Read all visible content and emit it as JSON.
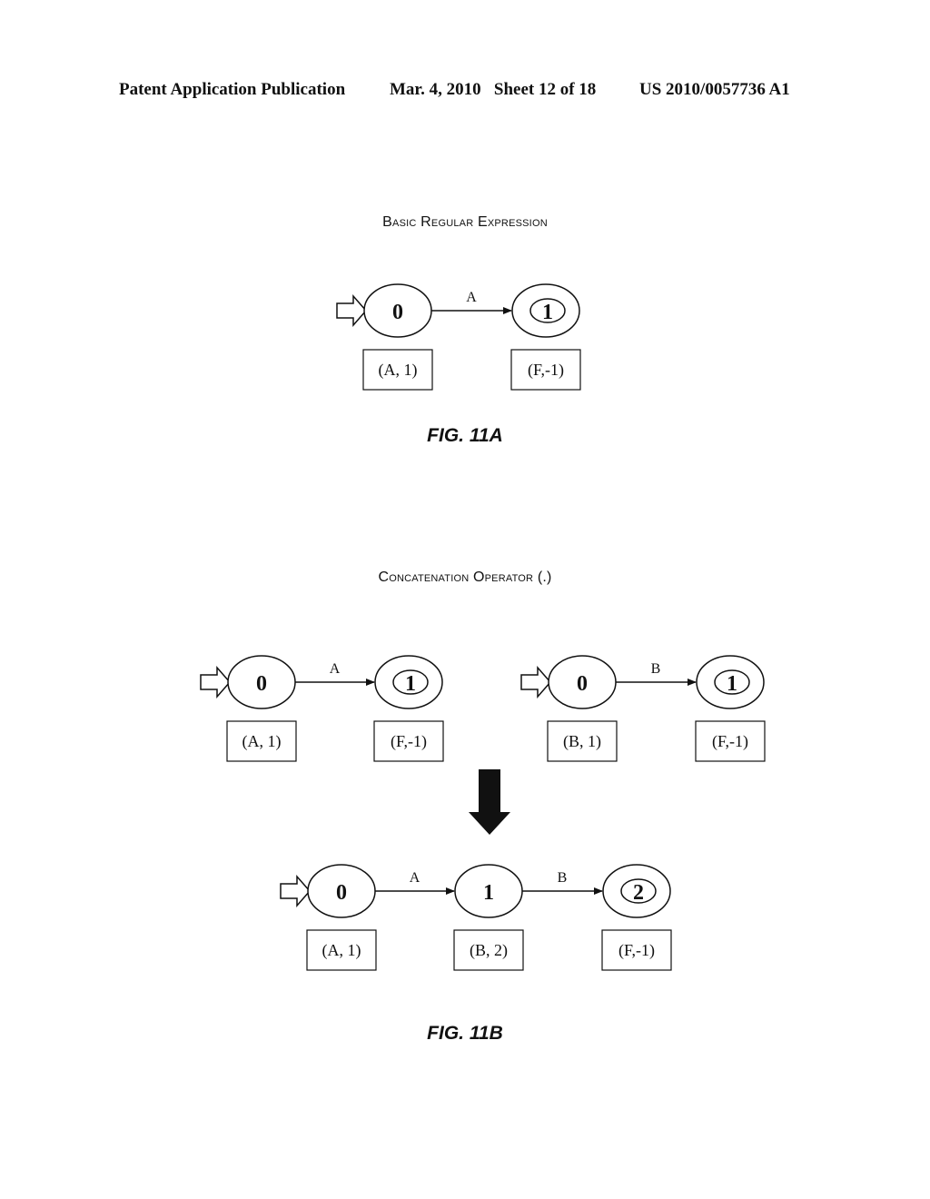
{
  "header": {
    "publication": "Patent Application Publication",
    "date_sheet": "Mar. 4, 2010   Sheet 12 of 18",
    "number": "US 2010/0057736 A1"
  },
  "fig11a": {
    "title": "Basic Regular Expression",
    "caption": "FIG. 11A",
    "states": [
      {
        "label": "0",
        "start": true,
        "accept": false,
        "entry": "(A, 1)"
      },
      {
        "label": "1",
        "start": false,
        "accept": true,
        "entry": "(F,-1)"
      }
    ],
    "transitions": [
      {
        "from": "0",
        "to": "1",
        "symbol": "A"
      }
    ]
  },
  "fig11b": {
    "title": "Concatenation Operator (.)",
    "caption": "FIG. 11B",
    "left_machine": {
      "states": [
        {
          "label": "0",
          "start": true,
          "accept": false,
          "entry": "(A, 1)"
        },
        {
          "label": "1",
          "start": false,
          "accept": true,
          "entry": "(F,-1)"
        }
      ],
      "transitions": [
        {
          "from": "0",
          "to": "1",
          "symbol": "A"
        }
      ]
    },
    "right_machine": {
      "states": [
        {
          "label": "0",
          "start": true,
          "accept": false,
          "entry": "(B, 1)"
        },
        {
          "label": "1",
          "start": false,
          "accept": true,
          "entry": "(F,-1)"
        }
      ],
      "transitions": [
        {
          "from": "0",
          "to": "1",
          "symbol": "B"
        }
      ]
    },
    "result_machine": {
      "states": [
        {
          "label": "0",
          "start": true,
          "accept": false,
          "entry": "(A, 1)"
        },
        {
          "label": "1",
          "start": false,
          "accept": false,
          "entry": "(B, 2)"
        },
        {
          "label": "2",
          "start": false,
          "accept": true,
          "entry": "(F,-1)"
        }
      ],
      "transitions": [
        {
          "from": "0",
          "to": "1",
          "symbol": "A"
        },
        {
          "from": "1",
          "to": "2",
          "symbol": "B"
        }
      ]
    }
  }
}
